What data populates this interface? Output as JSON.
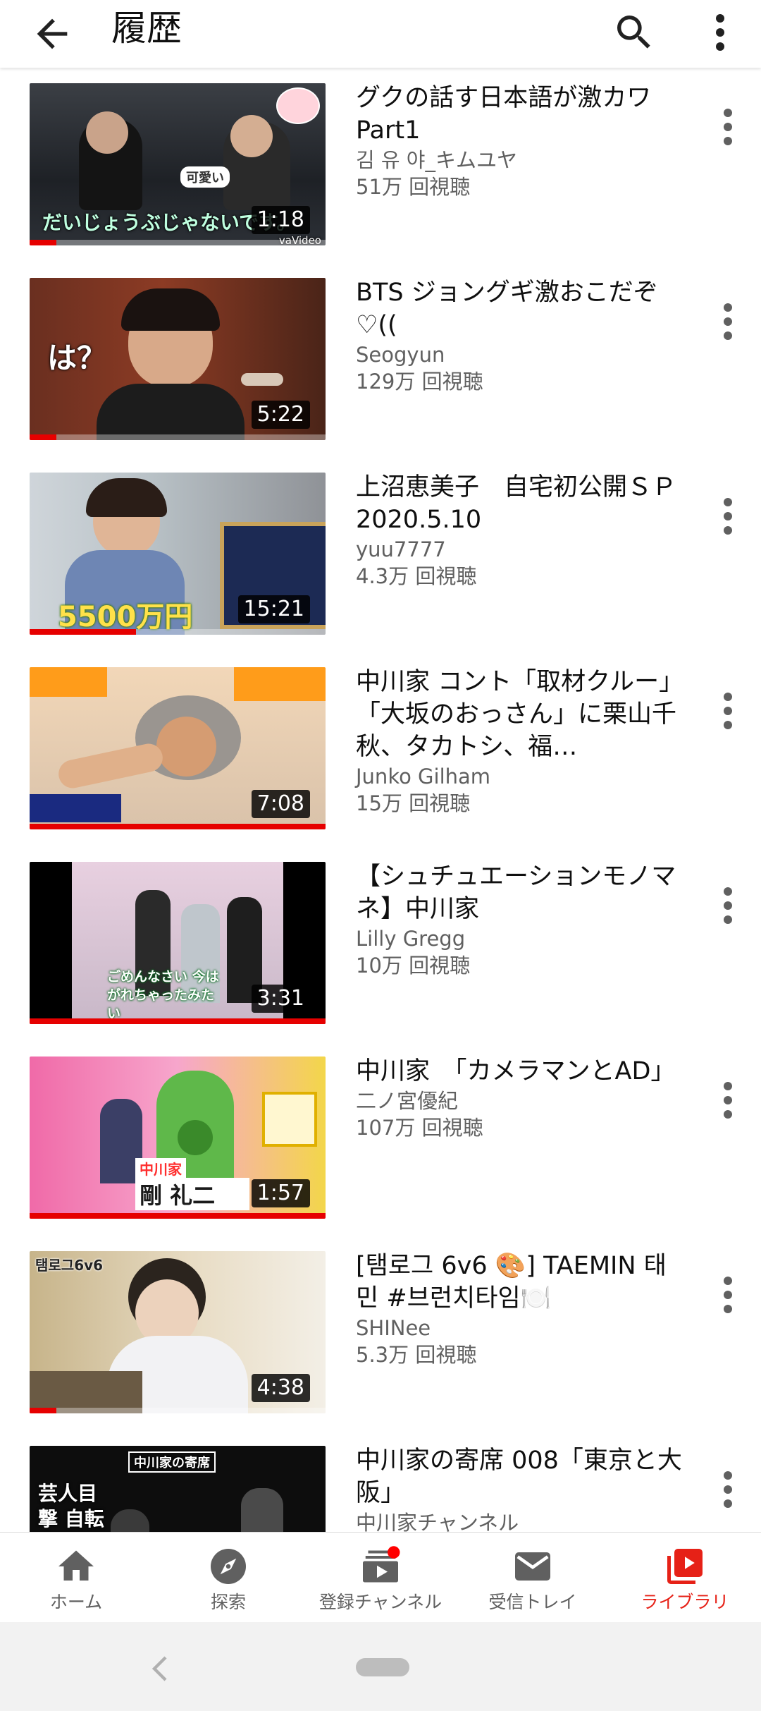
{
  "header": {
    "title": "履歴",
    "back_icon": "arrow-back-icon",
    "search_icon": "search-icon",
    "more_icon": "more-vert-icon"
  },
  "videos": [
    {
      "title": "グクの話す日本語が激カワPart1",
      "channel": "김 유 야_キムユヤ",
      "views": "51万 回視聴",
      "duration": "1:18",
      "progress": 0.09,
      "thumb_text": "だいじょうぶじゃないです。",
      "thumb_badge": "可愛い",
      "thumb_corner": "vaVideo"
    },
    {
      "title": "BTS ジョングギ激おこだぞ♡((",
      "channel": "Seogyun",
      "views": "129万 回視聴",
      "duration": "5:22",
      "progress": 0.09,
      "thumb_text": "は？"
    },
    {
      "title": "上沼恵美子　自宅初公開ＳＰ 2020.5.10",
      "channel": "yuu7777",
      "views": "4.3万 回視聴",
      "duration": "15:21",
      "progress": 0.36,
      "thumb_text": "5500万円"
    },
    {
      "title": "中川家 コント「取材クルー」「大坂のおっさん」に栗山千秋、タカトシ、福…",
      "channel": "Junko Gilham",
      "views": "15万 回視聴",
      "duration": "7:08",
      "progress": 1.0
    },
    {
      "title": "【シュチュエーションモノマネ】中川家",
      "channel": "Lilly Gregg",
      "views": "10万 回視聴",
      "duration": "3:31",
      "progress": 1.0,
      "thumb_text": "ごめんなさい 今はがれちゃったみたい"
    },
    {
      "title": "中川家　「カメラマンとAD」",
      "channel": "二ノ宮優紀",
      "views": "107万 回視聴",
      "duration": "1:57",
      "progress": 1.0,
      "thumb_text": "剛 礼二",
      "thumb_badge": "中川家"
    },
    {
      "title": "[탬로그 6v6 🎨] TAEMIN 태민 #브런치타임🍽️",
      "channel": "SHINee",
      "views": "5.3万 回視聴",
      "duration": "4:38",
      "progress": 0.09,
      "thumb_text": "탬로그6v6"
    },
    {
      "title": "中川家の寄席 008「東京と大阪」",
      "channel": "中川家チャンネル",
      "views": "",
      "duration": "",
      "progress": 0,
      "thumb_text": "芸人目撃 自転車",
      "thumb_badge": "中川家の寄席"
    }
  ],
  "nav": [
    {
      "label": "ホーム",
      "icon": "home-icon"
    },
    {
      "label": "探索",
      "icon": "explore-icon"
    },
    {
      "label": "登録チャンネル",
      "icon": "subscriptions-icon"
    },
    {
      "label": "受信トレイ",
      "icon": "inbox-icon"
    },
    {
      "label": "ライブラリ",
      "icon": "library-icon"
    }
  ],
  "colors": {
    "accent": "#e62117",
    "text_secondary": "#606060",
    "progress": "#e60000"
  },
  "system_nav": {
    "back_icon": "system-back-icon",
    "home_icon": "system-home-pill-icon"
  }
}
